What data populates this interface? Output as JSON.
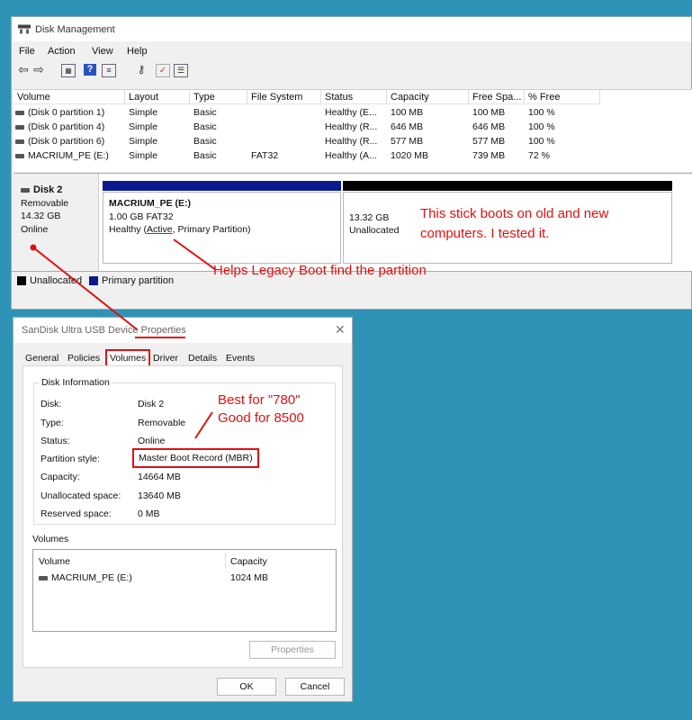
{
  "disk_management": {
    "title": "Disk Management",
    "menu": [
      "File",
      "Action",
      "View",
      "Help"
    ],
    "toolbar_icons": [
      "back-arrow-icon",
      "forward-arrow-icon",
      "grid-view-icon",
      "help-icon",
      "list-icon",
      "key-icon",
      "check-icon",
      "properties-icon"
    ],
    "columns": [
      "Volume",
      "Layout",
      "Type",
      "File System",
      "Status",
      "Capacity",
      "Free Spa...",
      "% Free"
    ],
    "rows": [
      [
        "(Disk 0 partition 1)",
        "Simple",
        "Basic",
        "",
        "Healthy (E...",
        "100 MB",
        "100 MB",
        "100 %"
      ],
      [
        "(Disk 0 partition 4)",
        "Simple",
        "Basic",
        "",
        "Healthy (R...",
        "646 MB",
        "646 MB",
        "100 %"
      ],
      [
        "(Disk 0 partition 6)",
        "Simple",
        "Basic",
        "",
        "Healthy (R...",
        "577 MB",
        "577 MB",
        "100 %"
      ],
      [
        "MACRIUM_PE (E:)",
        "Simple",
        "Basic",
        "FAT32",
        "Healthy (A...",
        "1020 MB",
        "739 MB",
        "72 %"
      ]
    ],
    "disk": {
      "name": "Disk 2",
      "kind": "Removable",
      "size": "14.32 GB",
      "state": "Online"
    },
    "volume_partition": {
      "name": "MACRIUM_PE  (E:)",
      "size_fs": "1.00 GB FAT32",
      "status_prefix": "Healthy (",
      "status_active": "Active",
      "status_suffix": ", Primary Partition)"
    },
    "unallocated_partition": {
      "size": "13.32 GB",
      "label": "Unallocated"
    },
    "legend": {
      "unallocated": "Unallocated",
      "primary": "Primary partition"
    },
    "colors": {
      "primary": "#0a1a8c",
      "unallocated": "#000000"
    }
  },
  "dialog": {
    "title": "SanDisk Ultra USB Device Properties",
    "tabs": [
      "General",
      "Policies",
      "Volumes",
      "Driver",
      "Details",
      "Events"
    ],
    "selected_tab": "Volumes",
    "group_title": "Disk Information",
    "fields": [
      {
        "label": "Disk:",
        "value": "Disk 2"
      },
      {
        "label": "Type:",
        "value": "Removable"
      },
      {
        "label": "Status:",
        "value": "Online"
      },
      {
        "label": "Partition style:",
        "value": "Master Boot Record (MBR)"
      },
      {
        "label": "Capacity:",
        "value": "14664 MB"
      },
      {
        "label": "Unallocated space:",
        "value": "13640 MB"
      },
      {
        "label": "Reserved space:",
        "value": "0 MB"
      }
    ],
    "volumes_title": "Volumes",
    "volumes_columns": [
      "Volume",
      "Capacity"
    ],
    "volumes_rows": [
      [
        "MACRIUM_PE (E:)",
        "1024 MB"
      ]
    ],
    "properties_button": "Properties",
    "ok_button": "OK",
    "cancel_button": "Cancel"
  },
  "annotations": {
    "boots_note_line1": "This stick boots on old and new",
    "boots_note_line2": "computers. I tested it.",
    "legacy_note": "Helps Legacy Boot find the partition",
    "best_line1": "Best for \"780\"",
    "best_line2": "Good for 8500",
    "annotation_color": "#e01010"
  }
}
